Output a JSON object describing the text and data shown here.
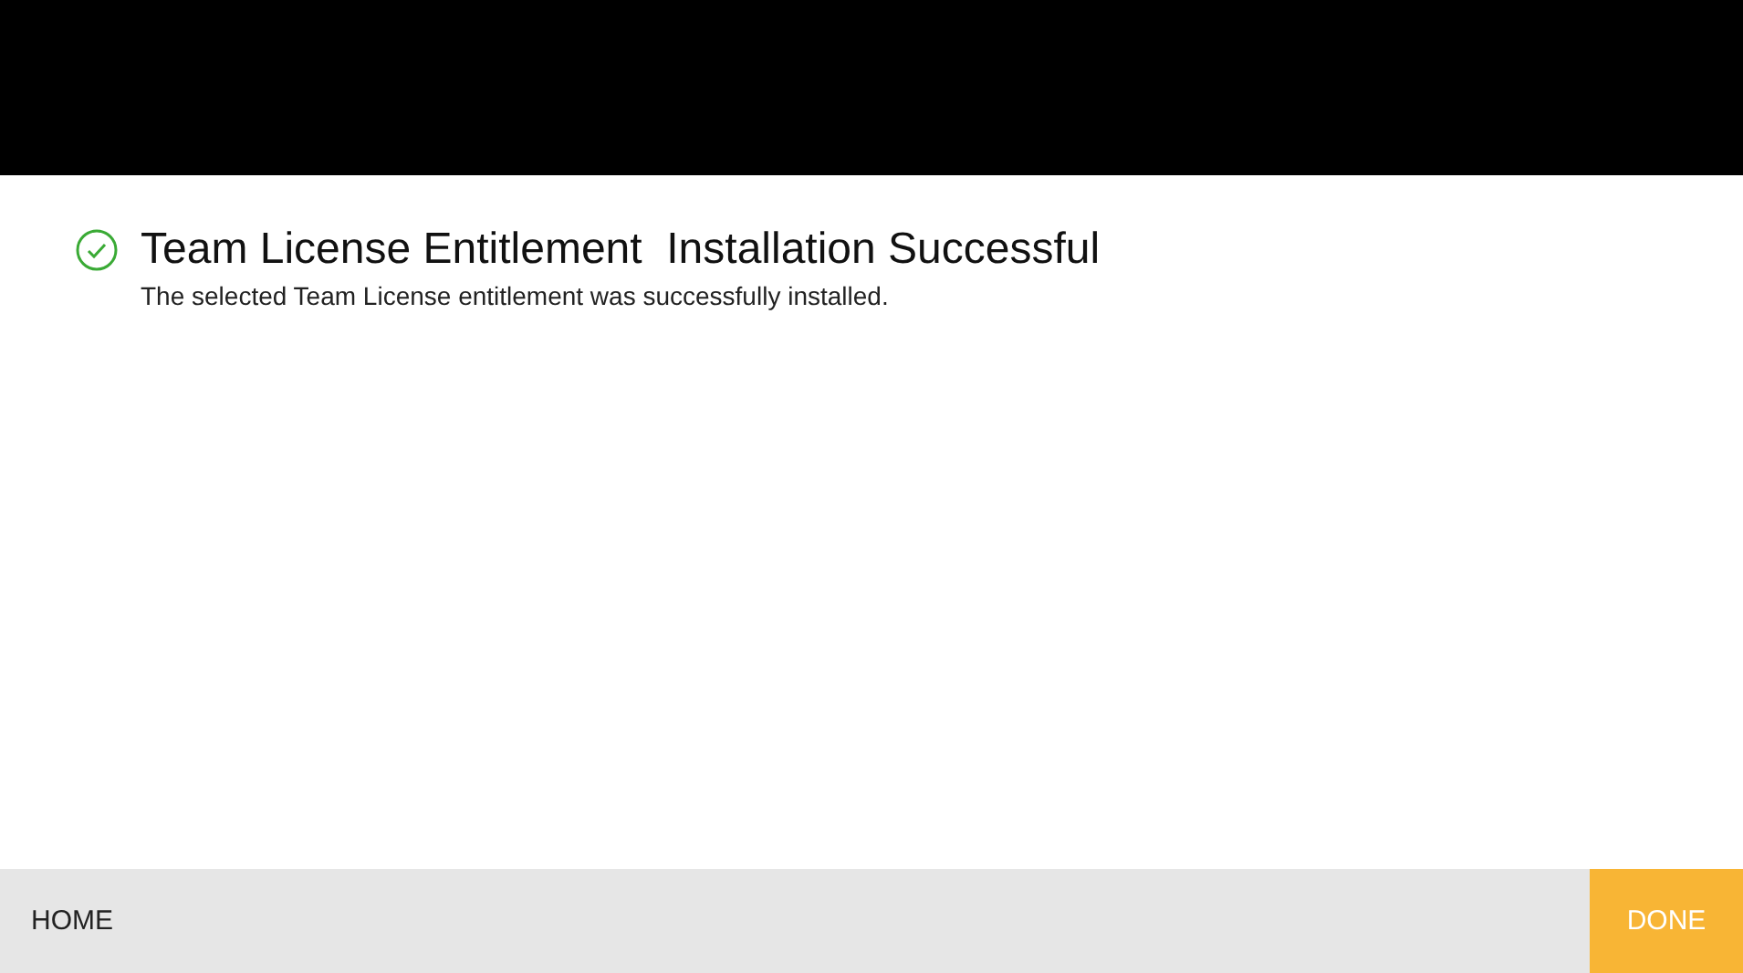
{
  "message": {
    "kind": "success",
    "title": "Team License Entitlement  Installation Successful",
    "description": "The selected Team License entitlement was successfully installed."
  },
  "footer": {
    "home": "HOME",
    "done": "DONE"
  }
}
